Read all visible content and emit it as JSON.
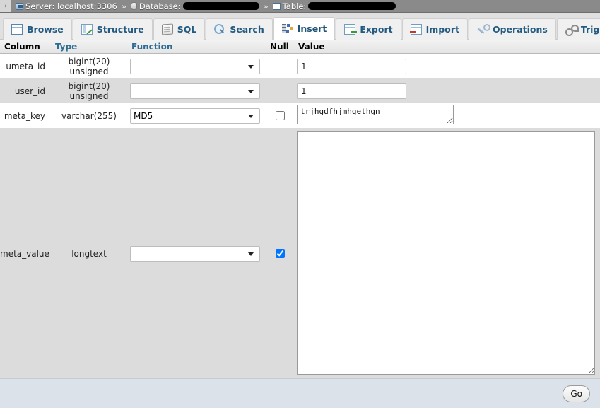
{
  "breadcrumb": {
    "toggle_glyph": "›",
    "items": [
      {
        "icon": "server-icon",
        "label": "Server: localhost:3306",
        "redacted": false
      },
      {
        "icon": "database-icon",
        "label": "Database:",
        "redacted": true
      },
      {
        "icon": "table-icon",
        "label": "Table:",
        "redacted": true
      }
    ],
    "separator": "»"
  },
  "tabs": [
    {
      "id": "browse",
      "label": "Browse",
      "icon": "browse-icon",
      "active": false
    },
    {
      "id": "structure",
      "label": "Structure",
      "icon": "structure-icon",
      "active": false
    },
    {
      "id": "sql",
      "label": "SQL",
      "icon": "sql-icon",
      "active": false
    },
    {
      "id": "search",
      "label": "Search",
      "icon": "search-icon",
      "active": false
    },
    {
      "id": "insert",
      "label": "Insert",
      "icon": "insert-icon",
      "active": true
    },
    {
      "id": "export",
      "label": "Export",
      "icon": "export-icon",
      "active": false
    },
    {
      "id": "import",
      "label": "Import",
      "icon": "import-icon",
      "active": false
    },
    {
      "id": "operations",
      "label": "Operations",
      "icon": "wrench-icon",
      "active": false
    },
    {
      "id": "triggers",
      "label": "Triggers",
      "icon": "triggers-icon",
      "active": false
    }
  ],
  "table": {
    "headers": {
      "column": "Column",
      "type": "Type",
      "function": "Function",
      "null": "Null",
      "value": "Value"
    },
    "rows": [
      {
        "column": "umeta_id",
        "type": "bigint(20) unsigned",
        "function_selected": "",
        "has_null": false,
        "null_checked": false,
        "value": "1",
        "value_control": "input"
      },
      {
        "column": "user_id",
        "type": "bigint(20) unsigned",
        "function_selected": "",
        "has_null": false,
        "null_checked": false,
        "value": "1",
        "value_control": "input"
      },
      {
        "column": "meta_key",
        "type": "varchar(255)",
        "function_selected": "MD5",
        "has_null": true,
        "null_checked": false,
        "value": "trjhgdfhjmhgethgn",
        "value_control": "textarea-small"
      },
      {
        "column": "meta_value",
        "type": "longtext",
        "function_selected": "",
        "has_null": true,
        "null_checked": true,
        "value": "",
        "value_control": "textarea-large"
      }
    ]
  },
  "footer": {
    "go_label": "Go"
  },
  "colors": {
    "breadcrumb_bg": "#8a8a8a",
    "tab_link": "#235a81",
    "header_link": "#2d6c94",
    "footer_bg": "#dbe2e9",
    "row_alt_bg": "#dcdcdc"
  }
}
